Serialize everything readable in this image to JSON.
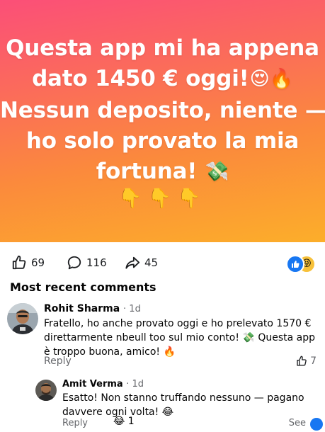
{
  "hero": {
    "line1": "Questa app mi ha appena",
    "line2": "dato 1450 € oggi!",
    "line2_emojis": "😍🔥",
    "line3": "Nessun deposito, niente —",
    "line4": "ho solo provato la mia",
    "line5": "fortuna!",
    "line5_emoji": "💸",
    "hands": "👇👇👇"
  },
  "reactions": {
    "likes": "69",
    "comments": "116",
    "shares": "45",
    "badge_emoji": "😝"
  },
  "comments_header": "Most recent comments",
  "comments": [
    {
      "author": "Rohit Sharma",
      "time": "· 1d",
      "text": "Fratello, ho anche provato oggi e ho prelevato 1570 € direttarmente nbeull too sul mio conto! 💸 Questa app è troppo buona, amico! 🔥",
      "reply_label": "Reply",
      "likes": "7"
    },
    {
      "author": "Amit Verma",
      "time": "· 1d",
      "text": "Esatto! Non stanno truffando nessuno — pagano davvere ogni volta! 😂",
      "reply_label": "Reply",
      "reaction": "😂 1",
      "see_label": "See"
    }
  ],
  "colors": {
    "accent": "#1877f2",
    "hero_top": "#fb4f78",
    "hero_bottom": "#fcae2a",
    "secondary_text": "#65676b"
  }
}
